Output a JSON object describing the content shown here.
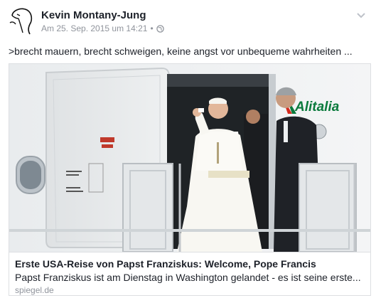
{
  "post": {
    "author": "Kevin Montany-Jung",
    "timestamp": "Am 25. Sep. 2015 um 14:21",
    "separator": "•",
    "privacy_icon": "globe-icon",
    "text": ">brecht mauern, brecht schweigen, keine angst vor unbequeme wahrheiten ..."
  },
  "link": {
    "title": "Erste USA-Reise von Papst Franziskus: Welcome, Pope Francis",
    "description": "Papst Franziskus ist am Dienstag in Washington gelandet - es ist seine erste...",
    "domain": "spiegel.de",
    "image_text": {
      "airline": "Alitalia",
      "door_sign_1": "EMERGENCY EXIT",
      "door_sign_2": "TO OPEN"
    }
  },
  "colors": {
    "text": "#1d2129",
    "meta": "#90949c",
    "border": "#dddfe2",
    "alitalia_green": "#0a7a3c",
    "alitalia_red": "#d52b1e"
  }
}
